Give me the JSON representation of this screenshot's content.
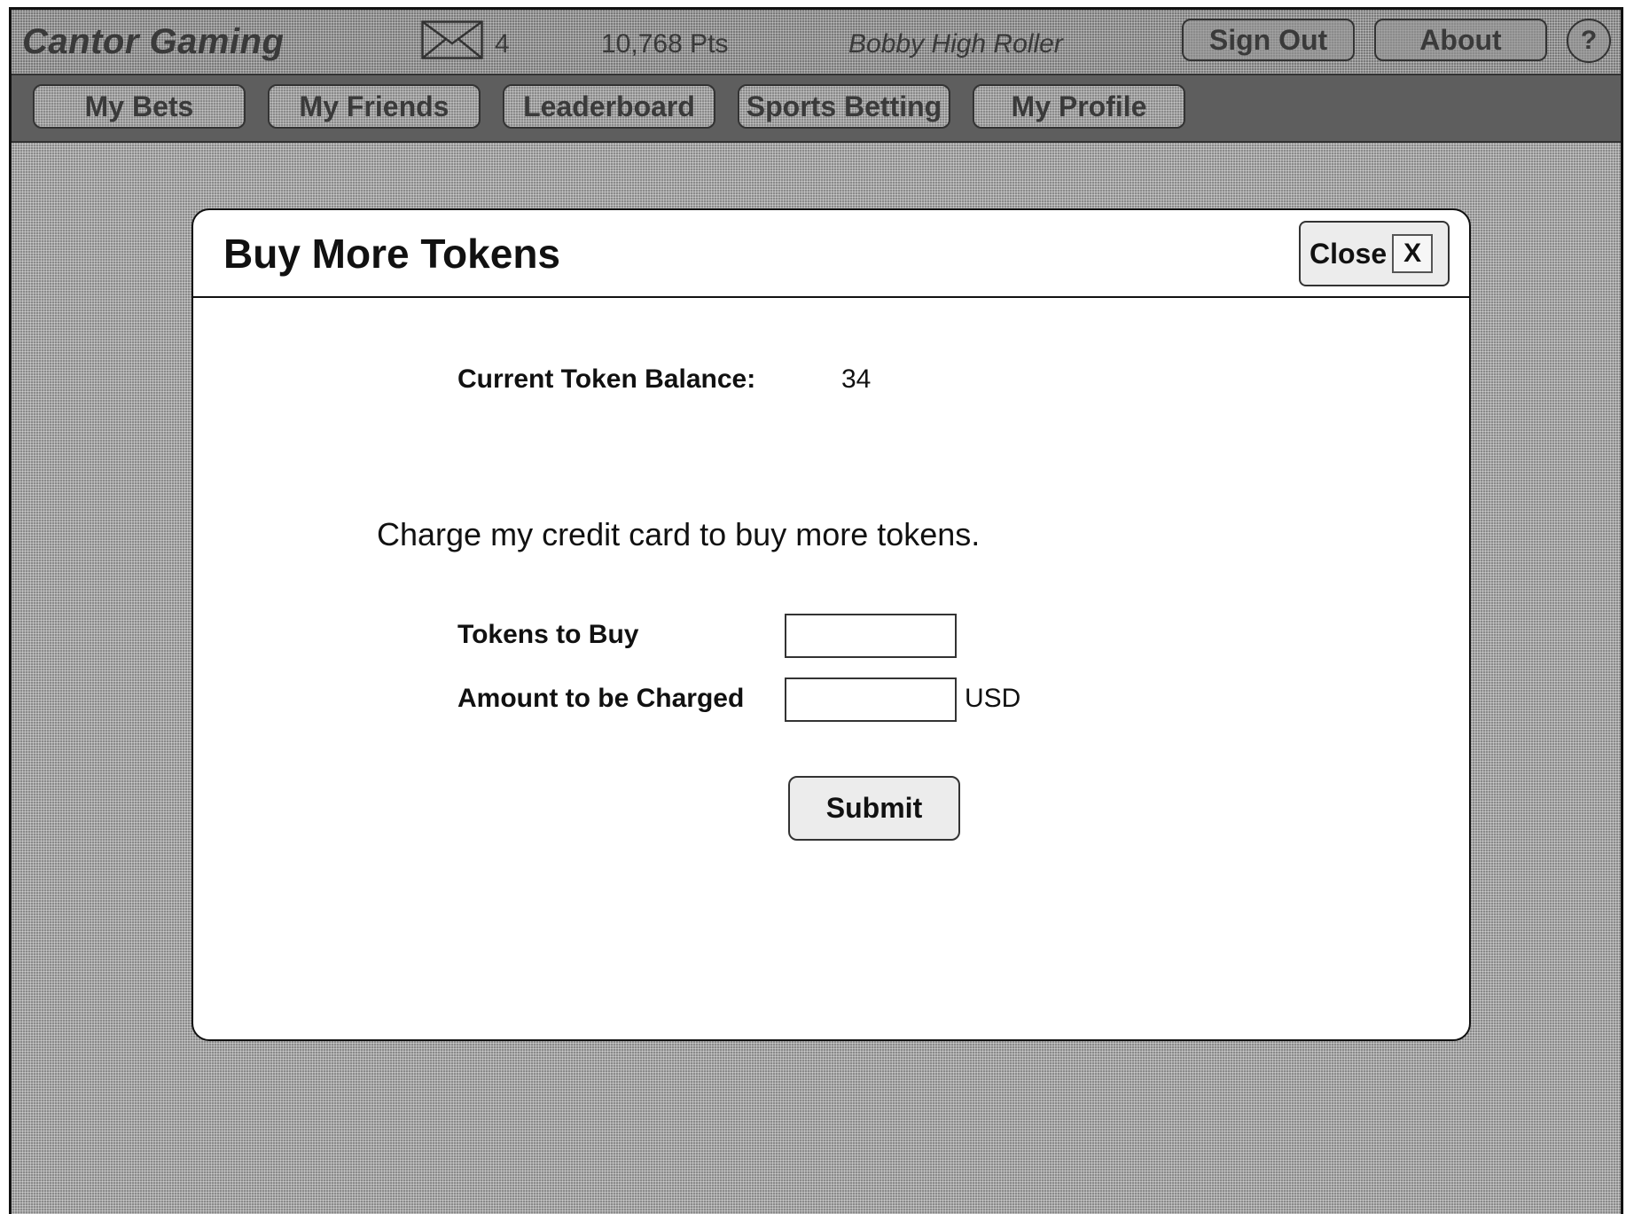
{
  "app": {
    "brand": "Cantor Gaming",
    "messages_count": "4",
    "points": "10,768 Pts",
    "username": "Bobby High Roller",
    "sign_out_label": "Sign Out",
    "about_label": "About",
    "help_label": "?"
  },
  "nav": {
    "tabs": [
      {
        "label": "My Bets"
      },
      {
        "label": "My Friends"
      },
      {
        "label": "Leaderboard"
      },
      {
        "label": "Sports Betting"
      },
      {
        "label": "My Profile"
      }
    ]
  },
  "modal": {
    "title": "Buy More Tokens",
    "close_label": "Close",
    "close_x": "X",
    "balance_label": "Current Token Balance:",
    "balance_value": "34",
    "charge_text": "Charge my credit card to buy more tokens.",
    "tokens_label": "Tokens to Buy",
    "tokens_value": "",
    "amount_label": "Amount to be Charged",
    "amount_value": "",
    "currency": "USD",
    "submit_label": "Submit"
  },
  "colors": {
    "overlay": "#8a8a8a",
    "nav_bar": "#5e5e5e",
    "modal_bg": "#ffffff",
    "button_bg": "#ececec"
  },
  "icons": {
    "mail": "envelope-icon",
    "help": "question-icon",
    "close": "close-icon"
  }
}
